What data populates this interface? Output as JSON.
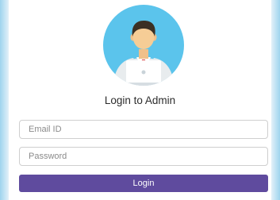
{
  "login": {
    "title": "Login to Admin",
    "email_placeholder": "Email ID",
    "password_placeholder": "Password",
    "button_label": "Login"
  },
  "avatar": {
    "icon": "admin-user-laptop-icon"
  },
  "colors": {
    "button": "#5f4b9e",
    "avatar_circle": "#5bc4ec",
    "edge": "#9ed4ee"
  }
}
